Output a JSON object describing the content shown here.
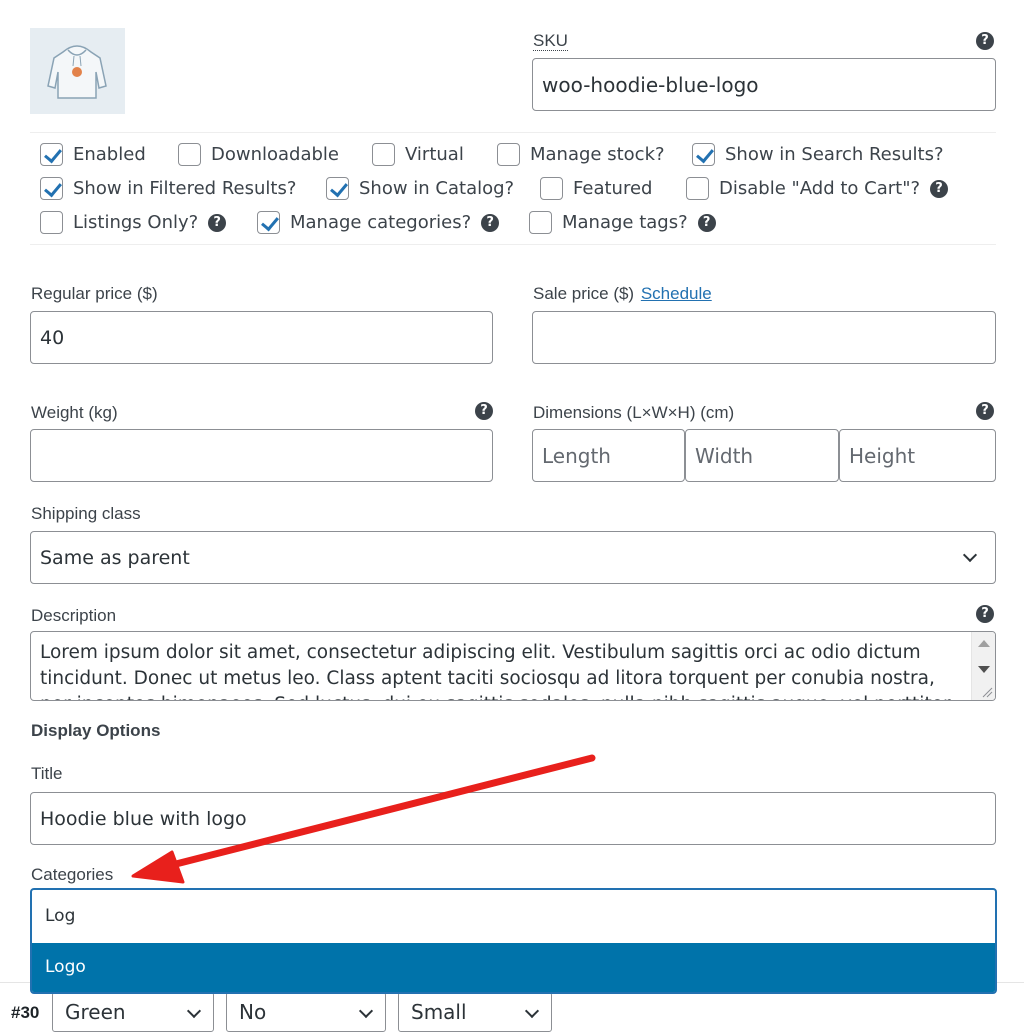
{
  "sku": {
    "label": "SKU",
    "value": "woo-hoodie-blue-logo"
  },
  "product_image": {
    "alt": "hoodie"
  },
  "options_row1": [
    {
      "label": "Enabled",
      "checked": true
    },
    {
      "label": "Downloadable",
      "checked": false
    },
    {
      "label": "Virtual",
      "checked": false
    },
    {
      "label": "Manage stock?",
      "checked": false
    },
    {
      "label": "Show in Search Results?",
      "checked": true
    }
  ],
  "options_row2": [
    {
      "label": "Show in Filtered Results?",
      "checked": true
    },
    {
      "label": "Show in Catalog?",
      "checked": true
    },
    {
      "label": "Featured",
      "checked": false
    },
    {
      "label": "Disable \"Add to Cart\"?",
      "checked": false
    }
  ],
  "options_row3": [
    {
      "label": "Listings Only?",
      "checked": false
    },
    {
      "label": "Manage categories?",
      "checked": true
    },
    {
      "label": "Manage tags?",
      "checked": false
    }
  ],
  "regular_price": {
    "label": "Regular price ($)",
    "value": "40"
  },
  "sale_price": {
    "label": "Sale price ($)",
    "link": "Schedule",
    "value": ""
  },
  "weight": {
    "label": "Weight (kg)",
    "value": ""
  },
  "dimensions": {
    "label": "Dimensions (L×W×H) (cm)",
    "length_placeholder": "Length",
    "width_placeholder": "Width",
    "height_placeholder": "Height"
  },
  "shipping_class": {
    "label": "Shipping class",
    "value": "Same as parent"
  },
  "description": {
    "label": "Description",
    "value": "Lorem ipsum dolor sit amet, consectetur adipiscing elit. Vestibulum sagittis orci ac odio dictum tincidunt. Donec ut metus leo. Class aptent taciti sociosqu ad litora torquent per conubia nostra, per inceptos himenaeos. Sed luctus, dui eu sagittis sodales, nulla nibh sagittis augue, vel porttitor"
  },
  "display_options": {
    "heading": "Display Options"
  },
  "title_field": {
    "label": "Title",
    "value": "Hoodie blue with logo"
  },
  "categories": {
    "label": "Categories",
    "search_value": "Log",
    "option": "Logo"
  },
  "variation": {
    "id": "#30",
    "color": "Green",
    "flag": "No",
    "size": "Small"
  },
  "help_glyph": "?",
  "colors": {
    "accent": "#2271b1",
    "highlight": "#0073aa",
    "annotation_arrow": "#e8201c"
  }
}
